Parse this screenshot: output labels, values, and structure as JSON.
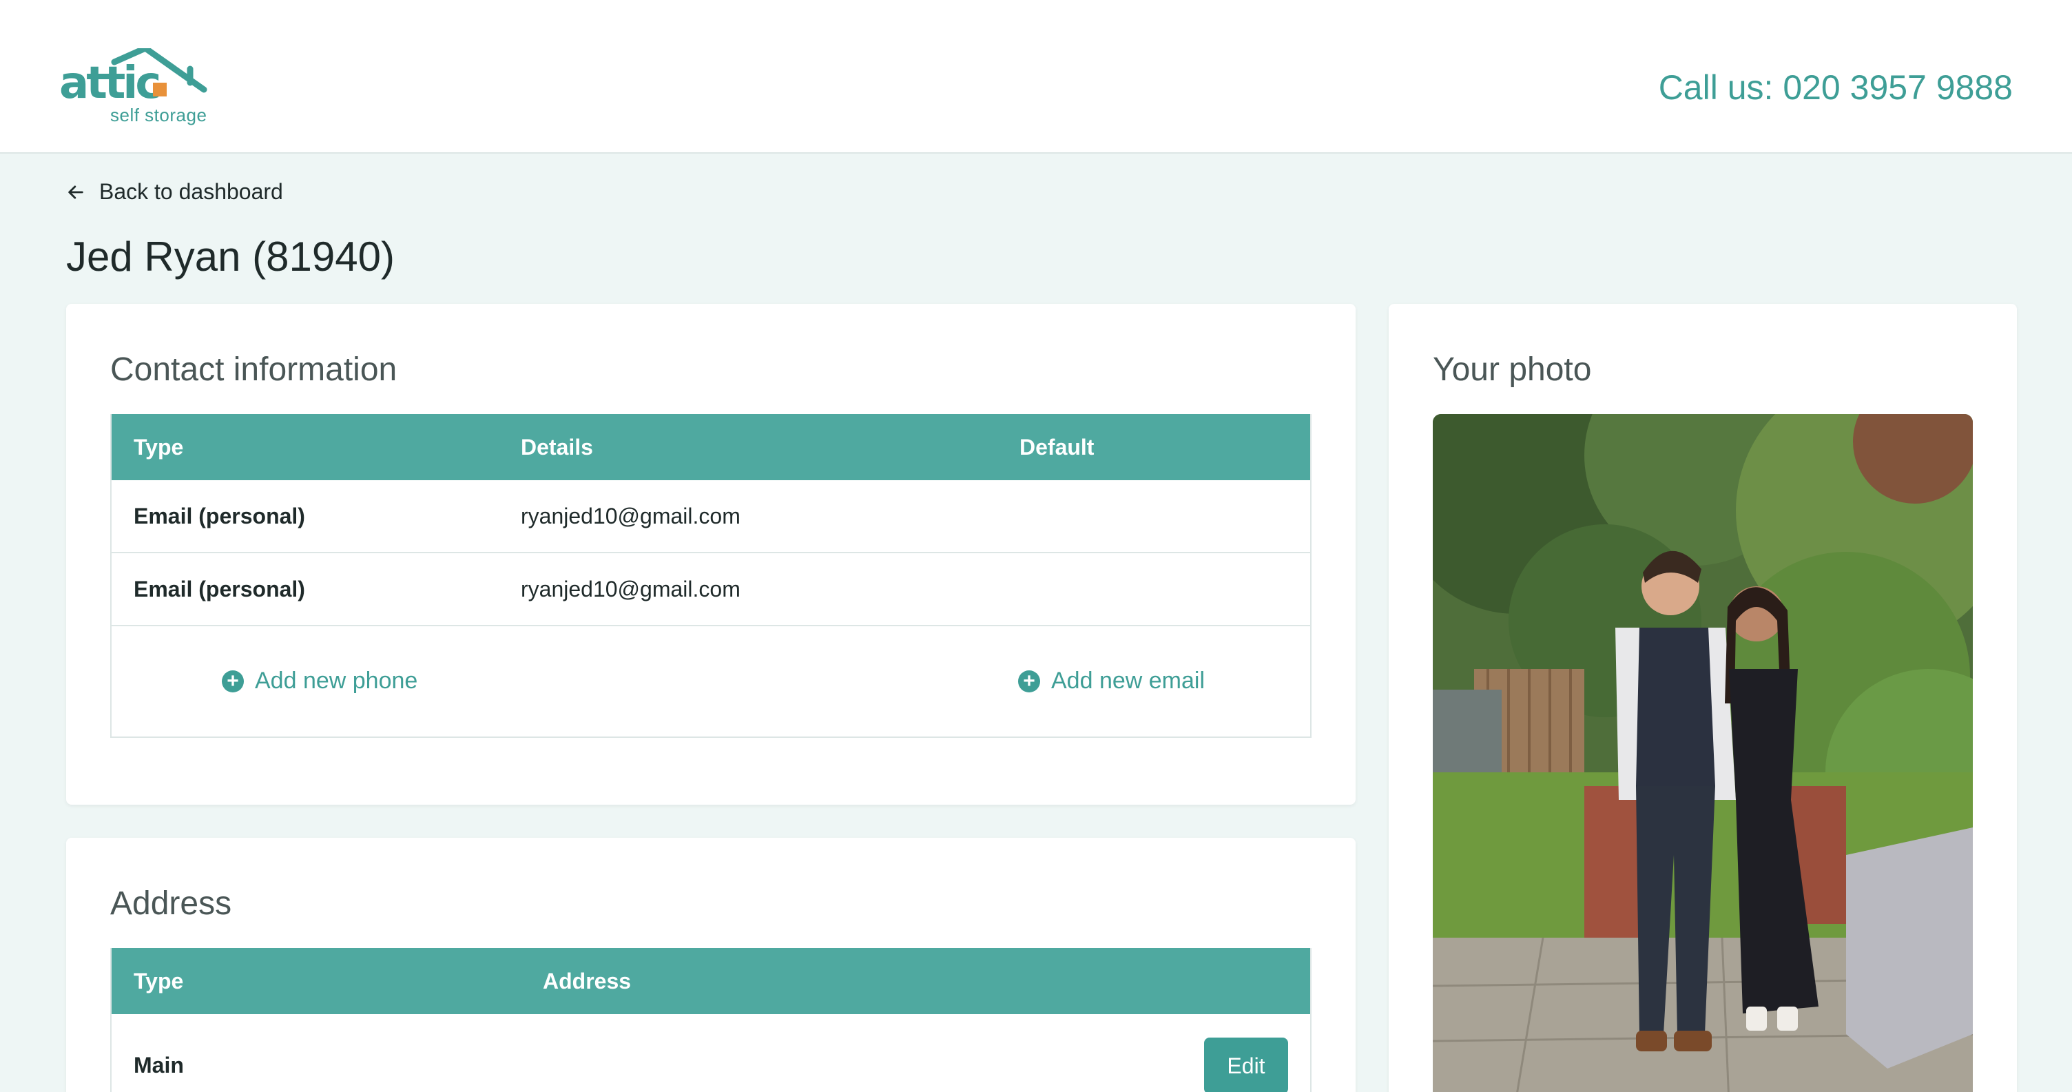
{
  "header": {
    "logo_sub": "self storage",
    "phone": "Call us: 020 3957 9888"
  },
  "nav": {
    "back_label": "Back to dashboard"
  },
  "page": {
    "title": "Jed Ryan (81940)"
  },
  "contact": {
    "title": "Contact information",
    "columns": [
      "Type",
      "Details",
      "Default"
    ],
    "rows": [
      {
        "type": "Email (personal)",
        "details": "ryanjed10@gmail.com",
        "default": ""
      },
      {
        "type": "Email (personal)",
        "details": "ryanjed10@gmail.com",
        "default": ""
      }
    ],
    "add_phone": "Add new phone",
    "add_email": "Add new email"
  },
  "address": {
    "title": "Address",
    "columns": [
      "Type",
      "Address"
    ],
    "rows": [
      {
        "type": "Main",
        "address": "",
        "edit_label": "Edit"
      }
    ]
  },
  "photo": {
    "title": "Your photo"
  },
  "colors": {
    "accent": "#4fa9a0",
    "accent_text": "#3e9e96",
    "logo_orange": "#e8913a",
    "background": "#eef6f5"
  },
  "icons": {
    "back": "arrow-left-icon",
    "add": "plus-circle-icon"
  }
}
